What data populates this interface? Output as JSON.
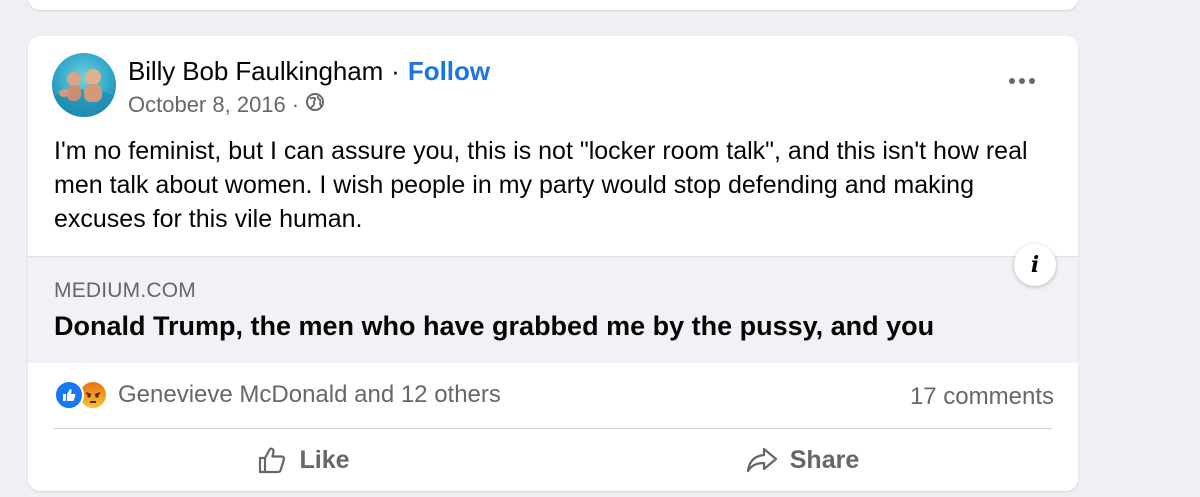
{
  "post": {
    "author": "Billy Bob Faulkingham",
    "dot": "·",
    "follow_label": "Follow",
    "date": "October 8, 2016",
    "meta_sep": "·",
    "privacy_icon": "globe-icon",
    "more_icon": "more-options-icon",
    "text": "I'm no feminist, but I can assure you, this is not \"locker room talk\", and this isn't how real men talk about women. I wish people in my party would stop defending and making excuses for this vile human."
  },
  "link_preview": {
    "domain": "MEDIUM.COM",
    "title": "Donald Trump, the men who have grabbed me by the pussy, and you",
    "info_label": "i"
  },
  "engagement": {
    "reaction_icons": [
      "like-reaction-icon",
      "angry-reaction-icon"
    ],
    "reactors": "Genevieve McDonald and 12 others",
    "comments": "17 comments"
  },
  "actions": {
    "like_label": "Like",
    "share_label": "Share"
  },
  "colors": {
    "background": "#eef0f3",
    "link_blue": "#1b74e4",
    "secondary_text": "#65676b",
    "like_blue": "#1877f2"
  }
}
